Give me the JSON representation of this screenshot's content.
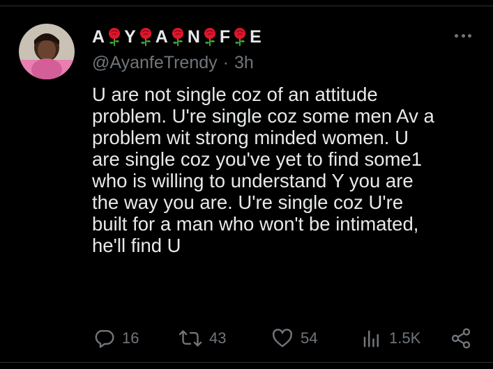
{
  "tweet": {
    "display_name_letters": [
      "A",
      "Y",
      "A",
      "N",
      "F",
      "E"
    ],
    "display_name_emoji": "rose-icon",
    "handle": "@AyanfeTrendy",
    "separator": "·",
    "time_ago": "3h",
    "text": "U are not single coz of an attitude\nproblem. U're single coz some men Av a\nproblem wit strong minded women. U\nare single coz you've yet to find some1\nwho is willing to understand Y you are\nthe way you are. U're single coz U're\nbuilt for a man who won't be intimated,\nhe'll find U"
  },
  "actions": {
    "replies": "16",
    "reposts": "43",
    "likes": "54",
    "views": "1.5K"
  },
  "colors": {
    "background": "#000000",
    "text_primary": "#e7e9ea",
    "text_secondary": "#71767b",
    "rose_red": "#e0162b",
    "rose_leaf": "#3fa535",
    "divider": "#2f3336"
  }
}
